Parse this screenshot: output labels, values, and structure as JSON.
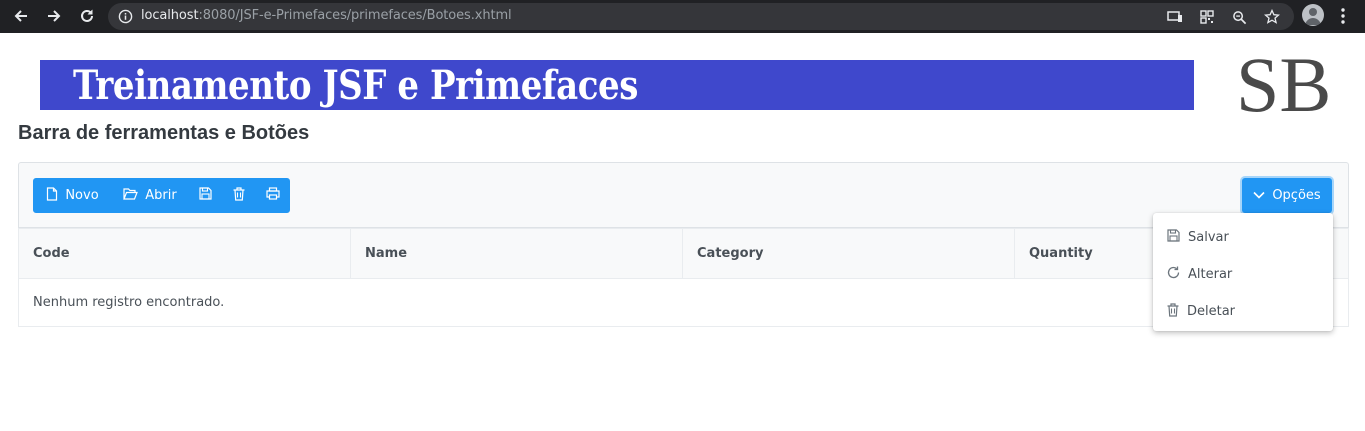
{
  "browser": {
    "url_host": "localhost",
    "url_rest": ":8080/JSF-e-Primefaces/primefaces/Botoes.xhtml",
    "icons": [
      "back-icon",
      "forward-icon",
      "reload-icon",
      "info-icon",
      "cast-icon",
      "qr-icon",
      "zoom-icon",
      "star-icon",
      "avatar",
      "menu-icon"
    ]
  },
  "banner": {
    "title": "Treinamento JSF e Primefaces",
    "logo_text": "SB",
    "background_color": "#3f48cc"
  },
  "page": {
    "title": "Barra de ferramentas e Botões"
  },
  "toolbar": {
    "novo_label": "Novo",
    "abrir_label": "Abrir",
    "opcoes_label": "Opções",
    "accent_color": "#2196f3"
  },
  "table": {
    "columns": [
      "Code",
      "Name",
      "Category",
      "Quantity"
    ],
    "empty_message": "Nenhum registro encontrado."
  },
  "menu": {
    "items": [
      {
        "label": "Salvar",
        "icon": "save-icon"
      },
      {
        "label": "Alterar",
        "icon": "refresh-icon"
      },
      {
        "label": "Deletar",
        "icon": "trash-icon"
      }
    ]
  }
}
